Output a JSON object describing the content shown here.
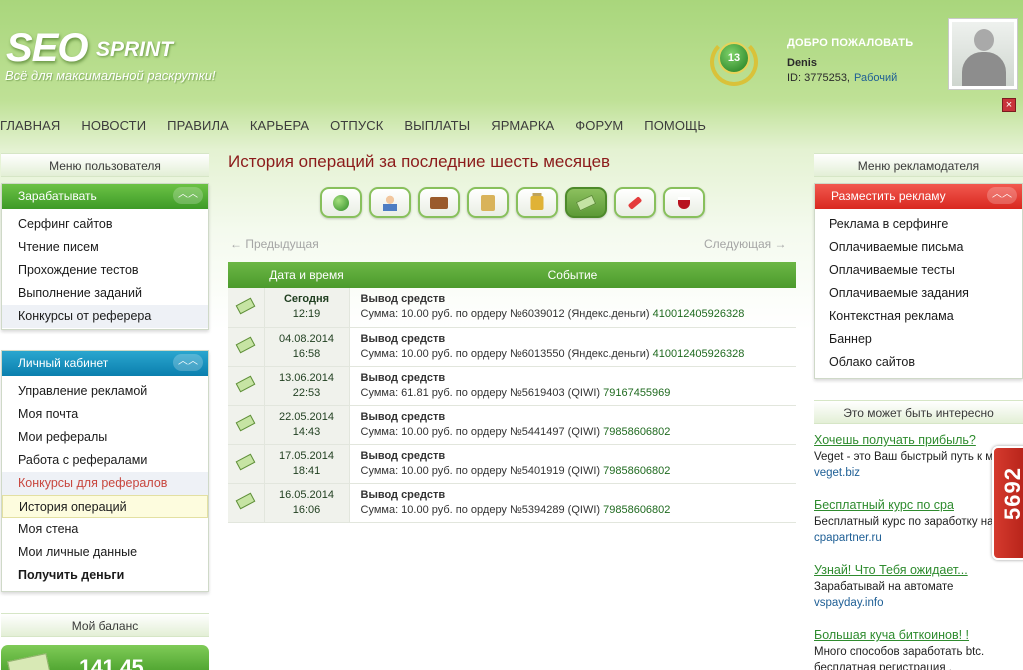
{
  "logo": {
    "seo": "SEO",
    "sprint": "SPRINT",
    "tagline": "Всё для максимальной раскрутки!"
  },
  "header": {
    "level": "13",
    "welcome": "ДОБРО ПОЖАЛОВАТЬ",
    "username": "Denis",
    "id_text": "ID: 3775253,",
    "status_link": "Рабочий",
    "close": "×"
  },
  "nav": [
    "ГЛАВНАЯ",
    "НОВОСТИ",
    "ПРАВИЛА",
    "КАРЬЕРА",
    "ОТПУСК",
    "ВЫПЛАТЫ",
    "ЯРМАРКА",
    "ФОРУМ",
    "ПОМОЩЬ"
  ],
  "left": {
    "menu_title": "Меню пользователя",
    "earn": {
      "title": "Зарабатывать",
      "items": [
        "Серфинг сайтов",
        "Чтение писем",
        "Прохождение тестов",
        "Выполнение заданий",
        "Конкурсы от реферера"
      ]
    },
    "cabinet": {
      "title": "Личный кабинет",
      "items": [
        "Управление рекламой",
        "Моя почта",
        "Мои рефералы",
        "Работа с рефералами",
        "Конкурсы для рефералов",
        "История операций",
        "Моя стена",
        "Мои личные данные",
        "Получить деньги"
      ]
    },
    "balance_title": "Мой баланс",
    "balance_value": "141.45"
  },
  "main": {
    "title": "История операций за последние шесть месяцев",
    "filters": [
      "globe",
      "user",
      "wallet",
      "bag",
      "lock",
      "money",
      "pin",
      "glass"
    ],
    "prev": "← Предыдущая",
    "next": "Следующая →",
    "col_date": "Дата и время",
    "col_event": "Событие",
    "rows": [
      {
        "date": "Сегодня",
        "time": "12:19",
        "title": "Вывод средств",
        "desc": "Сумма: 10.00 руб. по ордеру №6039012 (Яндекс.деньги)",
        "wallet": "410012405926328"
      },
      {
        "date": "04.08.2014",
        "time": "16:58",
        "title": "Вывод средств",
        "desc": "Сумма: 10.00 руб. по ордеру №6013550 (Яндекс.деньги)",
        "wallet": "410012405926328"
      },
      {
        "date": "13.06.2014",
        "time": "22:53",
        "title": "Вывод средств",
        "desc": "Сумма: 61.81 руб. по ордеру №5619403 (QIWI)",
        "wallet": "79167455969"
      },
      {
        "date": "22.05.2014",
        "time": "14:43",
        "title": "Вывод средств",
        "desc": "Сумма: 10.00 руб. по ордеру №5441497 (QIWI)",
        "wallet": "79858606802"
      },
      {
        "date": "17.05.2014",
        "time": "18:41",
        "title": "Вывод средств",
        "desc": "Сумма: 10.00 руб. по ордеру №5401919 (QIWI)",
        "wallet": "79858606802"
      },
      {
        "date": "16.05.2014",
        "time": "16:06",
        "title": "Вывод средств",
        "desc": "Сумма: 10.00 руб. по ордеру №5394289 (QIWI)",
        "wallet": "79858606802"
      }
    ]
  },
  "right": {
    "menu_title": "Меню рекламодателя",
    "place": {
      "title": "Разместить рекламу",
      "items": [
        "Реклама в серфинге",
        "Оплачиваемые письма",
        "Оплачиваемые тесты",
        "Оплачиваемые задания",
        "Контекстная реклама",
        "Баннер",
        "Облако сайтов"
      ]
    },
    "interest_title": "Это может быть интересно",
    "promos": [
      {
        "title": "Хочешь получать прибыль?",
        "desc": "Veget - это Ваш быстрый путь к м",
        "url": "veget.biz"
      },
      {
        "title": "Бесплатный курс по cpa",
        "desc": "Бесплатный курс по заработку на",
        "url": "cpapartner.ru"
      },
      {
        "title": "Узнай! Что Тебя ожидает...",
        "desc": "Зарабатывай на автомате",
        "url": "vspayday.info"
      },
      {
        "title": "Большая куча биткоинов! !",
        "desc": "Много способов заработать btc.",
        "desc2": "бесплатная регистрация ,"
      }
    ],
    "stamp": "5692"
  }
}
